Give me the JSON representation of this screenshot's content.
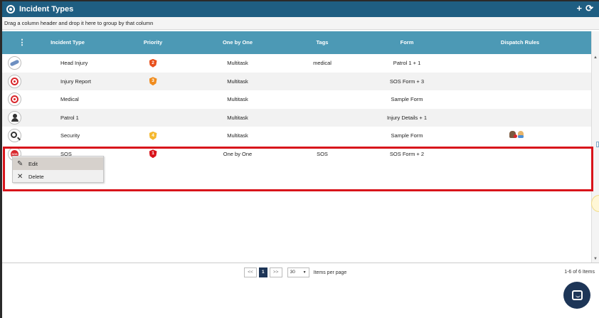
{
  "window": {
    "title": "Incident Types",
    "add_icon": "plus-icon",
    "refresh_icon": "refresh-icon",
    "accent": "#1f5e82"
  },
  "grouping_hint": "Drag a column header and drop it here to group by that column",
  "table": {
    "columns": [
      "Incident Type",
      "Priority",
      "One by One",
      "Tags",
      "Form",
      "Dispatch Rules"
    ],
    "menu_glyph": "⋮",
    "header_color": "#4c99b5",
    "rows": [
      {
        "icon": "bandage-icon",
        "name": "Head Injury",
        "priority": "2",
        "priority_color": "#e8501d",
        "mode": "Multitask",
        "tags": "medical",
        "form": "Patrol 1 + 1",
        "dispatch": ""
      },
      {
        "icon": "target-icon",
        "name": "Injury Report",
        "priority": "3",
        "priority_color": "#f08c1e",
        "mode": "Multitask",
        "tags": "",
        "form": "SOS Form + 3",
        "dispatch": ""
      },
      {
        "icon": "target-icon",
        "name": "Medical",
        "priority": "",
        "priority_color": "",
        "mode": "Multitask",
        "tags": "",
        "form": "Sample Form",
        "dispatch": ""
      },
      {
        "icon": "person-icon",
        "name": "Patrol 1",
        "priority": "",
        "priority_color": "",
        "mode": "Multitask",
        "tags": "",
        "form": "Injury Details + 1",
        "dispatch": ""
      },
      {
        "icon": "magnifier-icon",
        "name": "Security",
        "priority": "4",
        "priority_color": "#f5b82e",
        "mode": "Multitask",
        "tags": "",
        "form": "Sample Form",
        "dispatch": "people-icons"
      },
      {
        "icon": "sos-icon",
        "name": "SOS",
        "priority": "1",
        "priority_color": "#d9141b",
        "mode": "One by One",
        "tags": "SOS",
        "form": "SOS Form + 2",
        "dispatch": ""
      }
    ]
  },
  "context_menu": {
    "edit": "Edit",
    "delete": "Delete"
  },
  "pager": {
    "first": "<<",
    "current": "1",
    "last": ">>",
    "page_size": "30",
    "items_per_page": "Items per page",
    "count": "1-6 of 6 Items"
  },
  "highlight_color": "#d8141b"
}
